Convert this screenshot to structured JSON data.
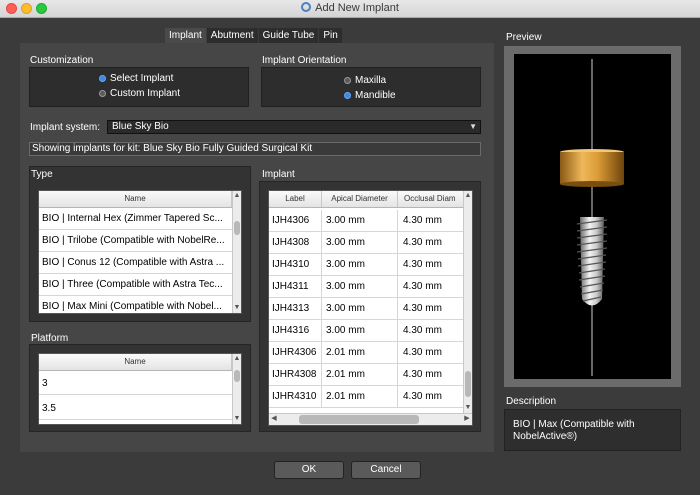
{
  "window": {
    "title": "Add New Implant"
  },
  "tabs": [
    {
      "label": "Implant",
      "active": true
    },
    {
      "label": "Abutment",
      "active": false
    },
    {
      "label": "Guide Tube",
      "active": false
    },
    {
      "label": "Pin",
      "active": false
    }
  ],
  "customization": {
    "title": "Customization",
    "options": [
      {
        "label": "Select Implant",
        "selected": true
      },
      {
        "label": "Custom Implant",
        "selected": false
      }
    ]
  },
  "orientation": {
    "title": "Implant Orientation",
    "options": [
      {
        "label": "Maxilla",
        "selected": false
      },
      {
        "label": "Mandible",
        "selected": true
      }
    ]
  },
  "implant_system": {
    "label": "Implant system:",
    "value": "Blue Sky Bio"
  },
  "kit_info": "Showing implants for kit:  Blue Sky Bio Fully Guided Surgical Kit",
  "type_section": {
    "title": "Type",
    "column": "Name",
    "rows": [
      "BIO | Internal Hex (Zimmer Tapered Sc...",
      "BIO | Trilobe (Compatible with NobelRe...",
      "BIO | Conus 12 (Compatible with Astra ...",
      "BIO | Three (Compatible with Astra Tec...",
      "BIO | Max Mini (Compatible with Nobel..."
    ]
  },
  "platform_section": {
    "title": "Platform",
    "column": "Name",
    "rows": [
      "3",
      "3.5"
    ]
  },
  "implant_section": {
    "title": "Implant",
    "columns": [
      "Label",
      "Apical Diameter",
      "Occlusal Diam"
    ],
    "rows": [
      [
        "IJH4306",
        "3.00 mm",
        "4.30 mm"
      ],
      [
        "IJH4308",
        "3.00 mm",
        "4.30 mm"
      ],
      [
        "IJH4310",
        "3.00 mm",
        "4.30 mm"
      ],
      [
        "IJH4311",
        "3.00 mm",
        "4.30 mm"
      ],
      [
        "IJH4313",
        "3.00 mm",
        "4.30 mm"
      ],
      [
        "IJH4316",
        "3.00 mm",
        "4.30 mm"
      ],
      [
        "IJHR4306",
        "2.01 mm",
        "4.30 mm"
      ],
      [
        "IJHR4308",
        "2.01 mm",
        "4.30 mm"
      ],
      [
        "IJHR4310",
        "2.01 mm",
        "4.30 mm"
      ]
    ]
  },
  "preview": {
    "title": "Preview"
  },
  "description": {
    "title": "Description",
    "text": "BIO | Max (Compatible with NobelActive®)"
  },
  "buttons": {
    "ok": "OK",
    "cancel": "Cancel"
  },
  "colors": {
    "abutment_gold": "#d99a35",
    "implant_silver": "#dcdcdc",
    "radio_selected": "#3b8ae6"
  }
}
